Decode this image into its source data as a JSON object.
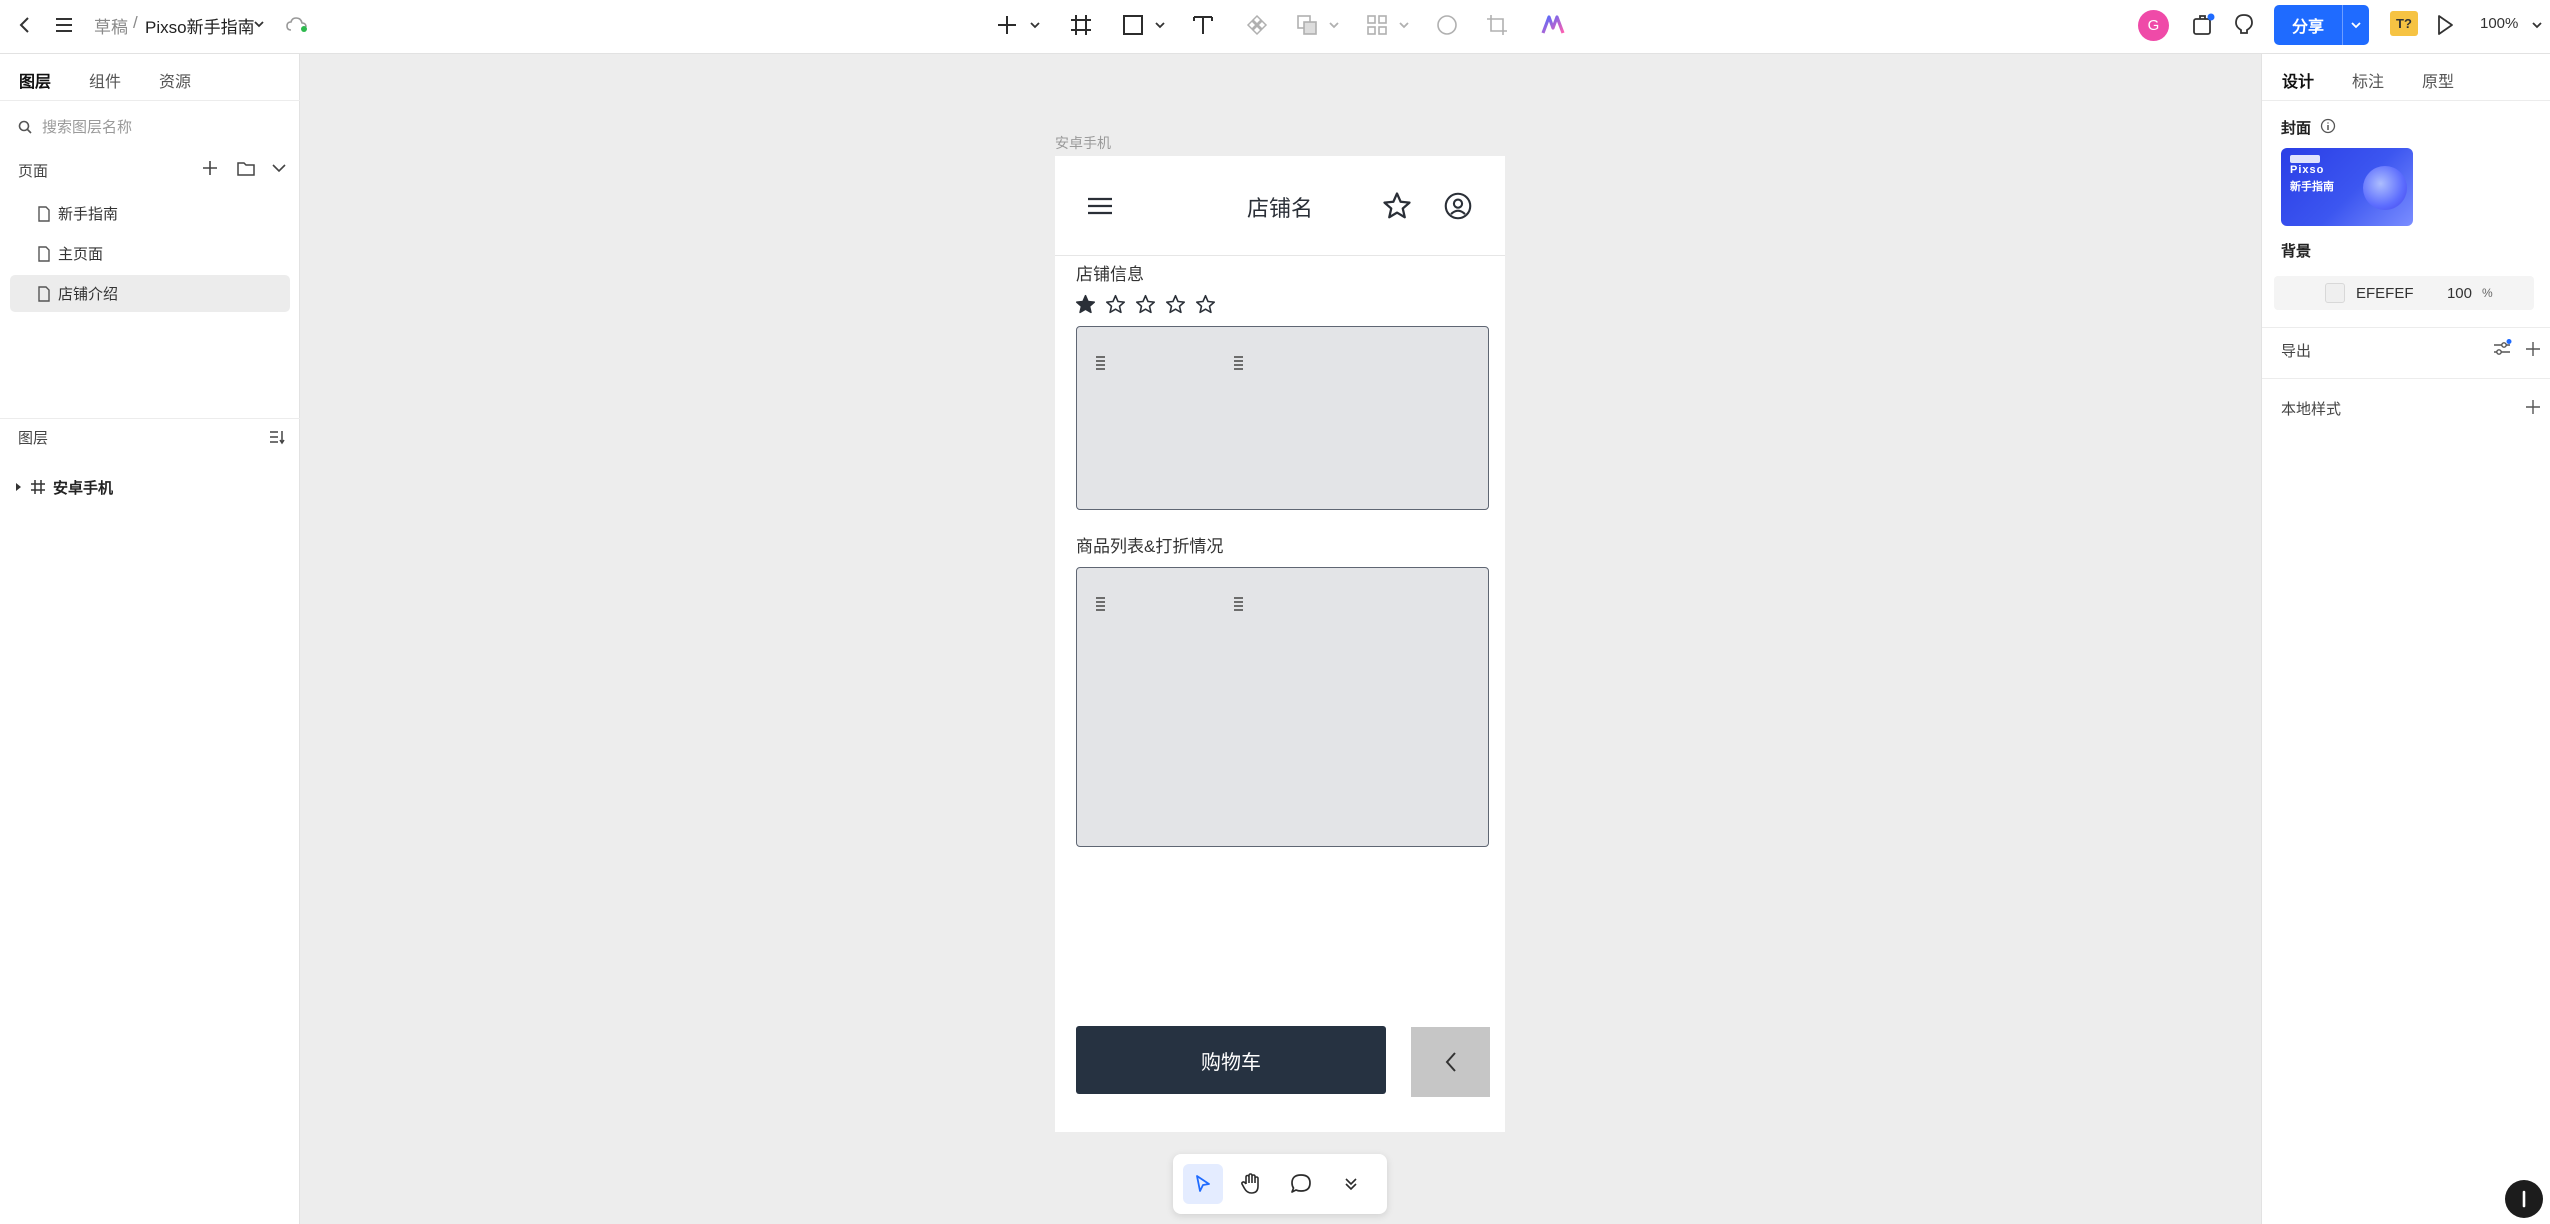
{
  "topbar": {
    "breadcrumb_root": "草稿",
    "breadcrumb_sep": "/",
    "file_name": "Pixso新手指南",
    "share_label": "分享",
    "avatar_letter": "G",
    "text_badge": "T?",
    "zoom": "100%"
  },
  "left_panel": {
    "tabs": [
      "图层",
      "组件",
      "资源"
    ],
    "search_placeholder": "搜索图层名称",
    "pages_title": "页面",
    "pages": [
      "新手指南",
      "主页面",
      "店铺介绍"
    ],
    "selected_page": "店铺介绍",
    "layers_title": "图层",
    "layers": [
      {
        "name": "安卓手机",
        "type": "frame"
      }
    ]
  },
  "right_panel": {
    "tabs": [
      "设计",
      "标注",
      "原型"
    ],
    "cover_label": "封面",
    "cover_thumb": {
      "line1": "Pixso",
      "line2": "新手指南"
    },
    "background_label": "背景",
    "background": {
      "hex": "EFEFEF",
      "opacity": "100",
      "unit": "%"
    },
    "export_label": "导出",
    "local_styles_label": "本地样式"
  },
  "canvas": {
    "frame_name": "安卓手机",
    "phone": {
      "title": "店铺名",
      "section1": "店铺信息",
      "rating": {
        "filled": 1,
        "total": 5
      },
      "section2": "商品列表&打折情况",
      "cart_button": "购物车"
    }
  },
  "colors": {
    "accent": "#1f6bff",
    "dark_button": "#263241",
    "placeholder_fill": "#e3e4e7",
    "canvas_bg": "#ededed",
    "avatar": "#ef4aa8"
  },
  "dock_tools": [
    "pointer-icon",
    "hand-icon",
    "comment-icon",
    "chevron-double-down-icon"
  ]
}
